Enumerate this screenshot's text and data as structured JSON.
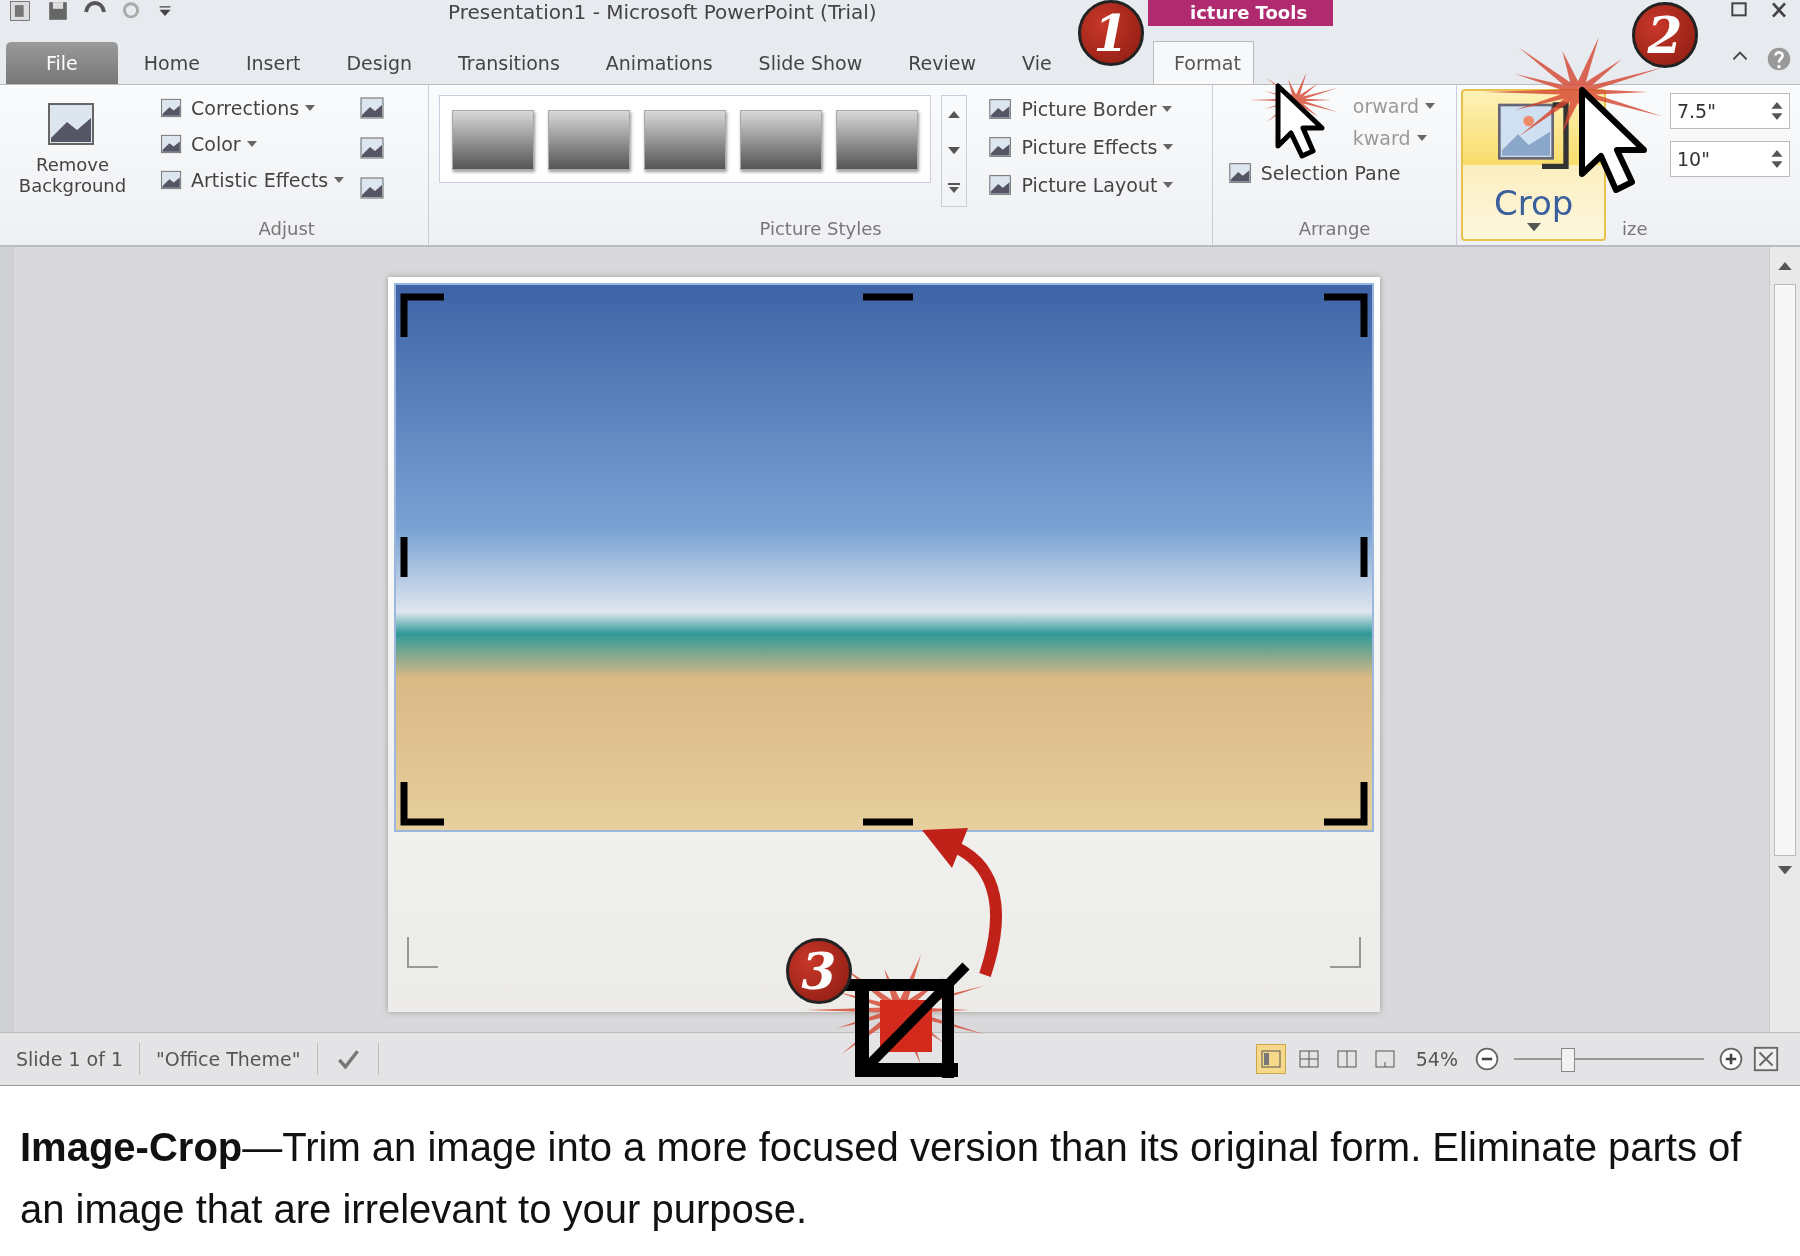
{
  "window": {
    "title": "Presentation1  -  Microsoft PowerPoint (Trial)",
    "context_header": "icture Tools"
  },
  "tabs": [
    {
      "label": "File",
      "kind": "file",
      "selected": false
    },
    {
      "label": "Home",
      "kind": "plain",
      "selected": false
    },
    {
      "label": "Insert",
      "kind": "plain",
      "selected": false
    },
    {
      "label": "Design",
      "kind": "plain",
      "selected": false
    },
    {
      "label": "Transitions",
      "kind": "plain",
      "selected": false
    },
    {
      "label": "Animations",
      "kind": "plain",
      "selected": false
    },
    {
      "label": "Slide Show",
      "kind": "plain",
      "selected": false
    },
    {
      "label": "Review",
      "kind": "plain",
      "selected": false
    },
    {
      "label": "Vie",
      "kind": "plain",
      "selected": false
    },
    {
      "label": "Format",
      "kind": "context",
      "selected": true
    }
  ],
  "ribbon": {
    "remove_background": "Remove Background",
    "adjust": {
      "items": [
        "Corrections",
        "Color",
        "Artistic Effects"
      ],
      "label": "Adjust"
    },
    "picture_styles": {
      "label": "Picture Styles"
    },
    "picture_commands": [
      "Picture Border",
      "Picture Effects",
      "Picture Layout"
    ],
    "arrange": {
      "items": [
        "orward",
        "kward",
        "Selection Pane"
      ],
      "label": "Arrange"
    },
    "crop": {
      "label": "Crop"
    },
    "size": {
      "fields": [
        "7.5\"",
        "10\""
      ],
      "label": "ize"
    }
  },
  "status_bar": {
    "slide": "Slide 1 of 1",
    "theme": "\"Office Theme\"",
    "views": [
      {
        "selected": true
      },
      {
        "selected": false
      },
      {
        "selected": false
      },
      {
        "selected": false
      }
    ],
    "zoom": "54%",
    "zoom_slider": {
      "level": 0.28
    }
  },
  "annotations": [
    {
      "label": "1"
    },
    {
      "label": "2"
    },
    {
      "label": "3"
    }
  ],
  "caption": "**Image-Crop**—Trim an image into a more focused version than its original form. Eliminate parts of an image that are irrelevant to your purpose."
}
